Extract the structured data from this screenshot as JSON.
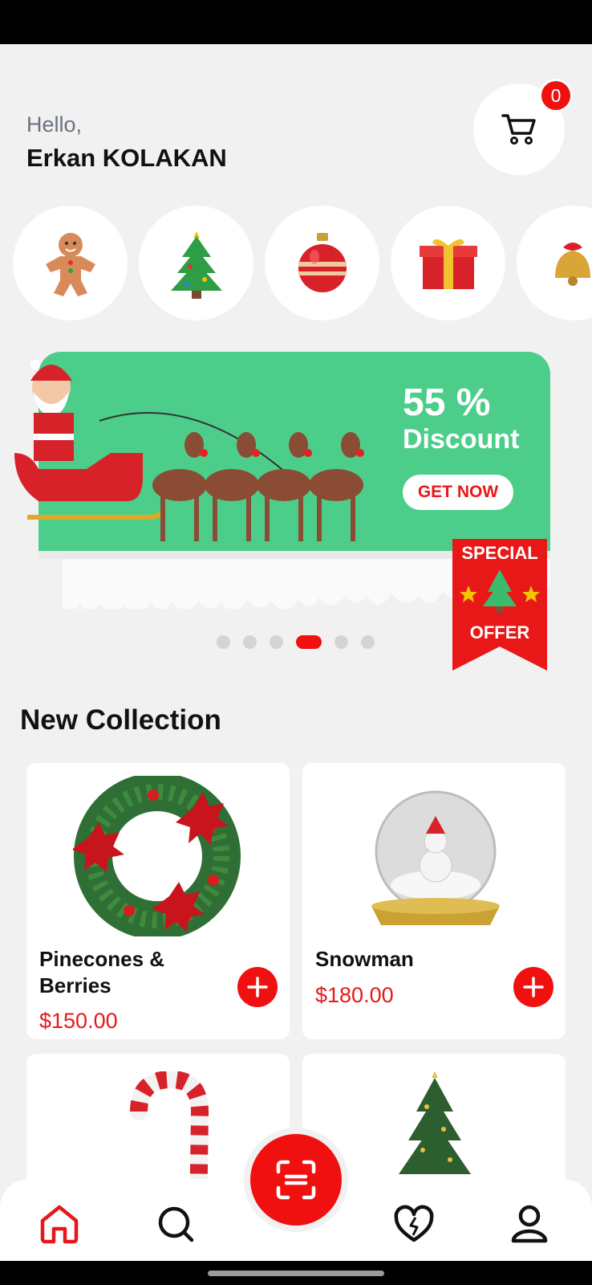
{
  "header": {
    "greeting": "Hello,",
    "user_name": "Erkan KOLAKAN",
    "cart_count": "0"
  },
  "categories": [
    {
      "icon": "gingerbread-icon"
    },
    {
      "icon": "christmas-tree-icon"
    },
    {
      "icon": "ornament-ball-icon"
    },
    {
      "icon": "gift-box-icon"
    },
    {
      "icon": "bell-icon"
    }
  ],
  "banner": {
    "headline": "55 %",
    "subline": "Discount",
    "cta": "GET NOW",
    "badge_top": "SPECIAL",
    "badge_bottom": "OFFER",
    "total_slides": 6,
    "active_slide": 4
  },
  "section": {
    "title": "New Collection"
  },
  "products": [
    {
      "name": "Pinecones & Berries",
      "price": "$150.00",
      "image": "wreath-image"
    },
    {
      "name": "Snowman",
      "price": "$180.00",
      "image": "snow-globe-image"
    },
    {
      "name": "",
      "price": "",
      "image": "candy-cane-image"
    },
    {
      "name": "",
      "price": "",
      "image": "christmas-tree-image"
    }
  ],
  "colors": {
    "accent": "#f01010",
    "banner_green": "#4cce8a",
    "background": "#f1f1f1"
  },
  "tabbar": {
    "items": [
      "home-icon",
      "search-icon",
      "scan-icon",
      "heart-icon",
      "profile-icon"
    ],
    "active": "home-icon"
  }
}
